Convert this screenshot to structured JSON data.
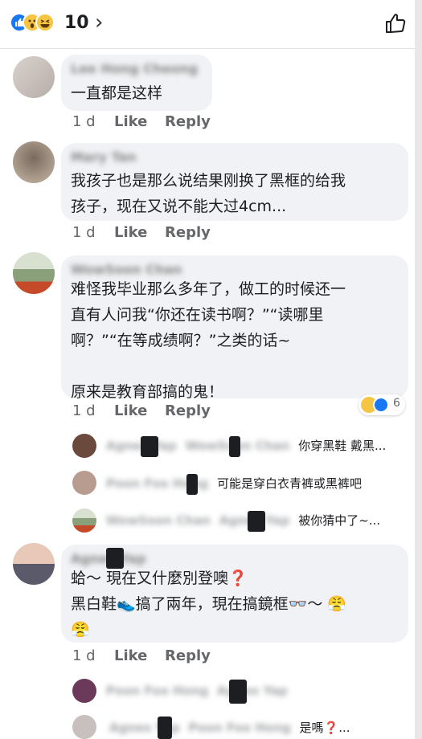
{
  "header": {
    "reaction_icons": [
      "like-icon",
      "wow-icon",
      "haha-icon"
    ],
    "reaction_count": "10",
    "chevron": "›",
    "like_icon": "thumb-up-icon"
  },
  "actions": {
    "like": "Like",
    "reply": "Reply"
  },
  "comments": [
    {
      "author": "Lee Hong Cheong",
      "text": "一直都是这样",
      "time": "1 d"
    },
    {
      "author": "Mary Tan",
      "text": "我孩子也是那么说结果刚换了黑框的给我\n孩子，现在又说不能大过4cm...",
      "time": "1 d"
    },
    {
      "author": "WowSoon Chan",
      "text": "难怪我毕业那么多年了，做工的时候还一\n直有人问我“你还在读书啊？”“读哪里\n啊？”“在等成绩啊？”之类的话~\n\n原来是教育部搞的鬼！",
      "time": "1 d",
      "reaction_count": "6"
    },
    {
      "author": "Agnes Yap",
      "text": "蛤～ 現在又什麼別登噢❓\n黑白鞋👟搞了兩年，現在搞鏡框👓～ 😤\n😤",
      "time": "1 d"
    }
  ],
  "replies_a": [
    {
      "name": "Agnes Yap",
      "tag": "WowSoon Chan",
      "text": "你穿黑鞋 戴黑..."
    },
    {
      "name": "Poon Foo Hong",
      "tag": "",
      "text": "可能是穿白衣青裤或黑裤吧"
    },
    {
      "name": "WowSoon Chan",
      "tag": "Agnes Yap",
      "text": "被你猜中了~..."
    }
  ],
  "replies_b": [
    {
      "name": "Poon Foo Hong",
      "tag": "Agnes Yap",
      "text": ""
    },
    {
      "name": "Agnes Yap",
      "tag": "Poon Foo Hong",
      "text": "是嗎❓..."
    }
  ],
  "colors": {
    "like_blue": "#1877f2",
    "bubble": "#f0f2f5",
    "muted": "#65676b"
  }
}
